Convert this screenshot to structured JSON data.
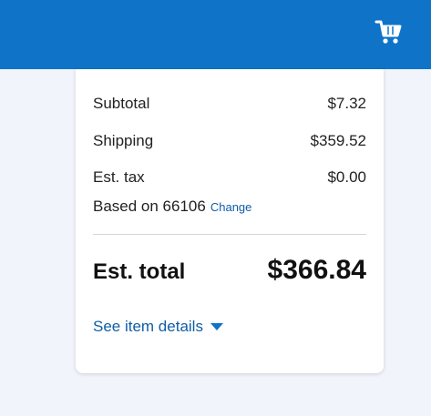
{
  "header": {
    "cart_icon": "shopping-cart-icon"
  },
  "summary": {
    "subtotal_label": "Subtotal",
    "subtotal_value": "$7.32",
    "shipping_label": "Shipping",
    "shipping_value": "$359.52",
    "tax_label": "Est. tax",
    "tax_value": "$0.00",
    "based_on_text": "Based on 66106",
    "change_link": "Change",
    "total_label": "Est. total",
    "total_value": "$366.84",
    "details_link": "See item details"
  },
  "colors": {
    "brand": "#0f74c8",
    "link": "#0f5ea8",
    "page_bg": "#f1f5fb"
  }
}
